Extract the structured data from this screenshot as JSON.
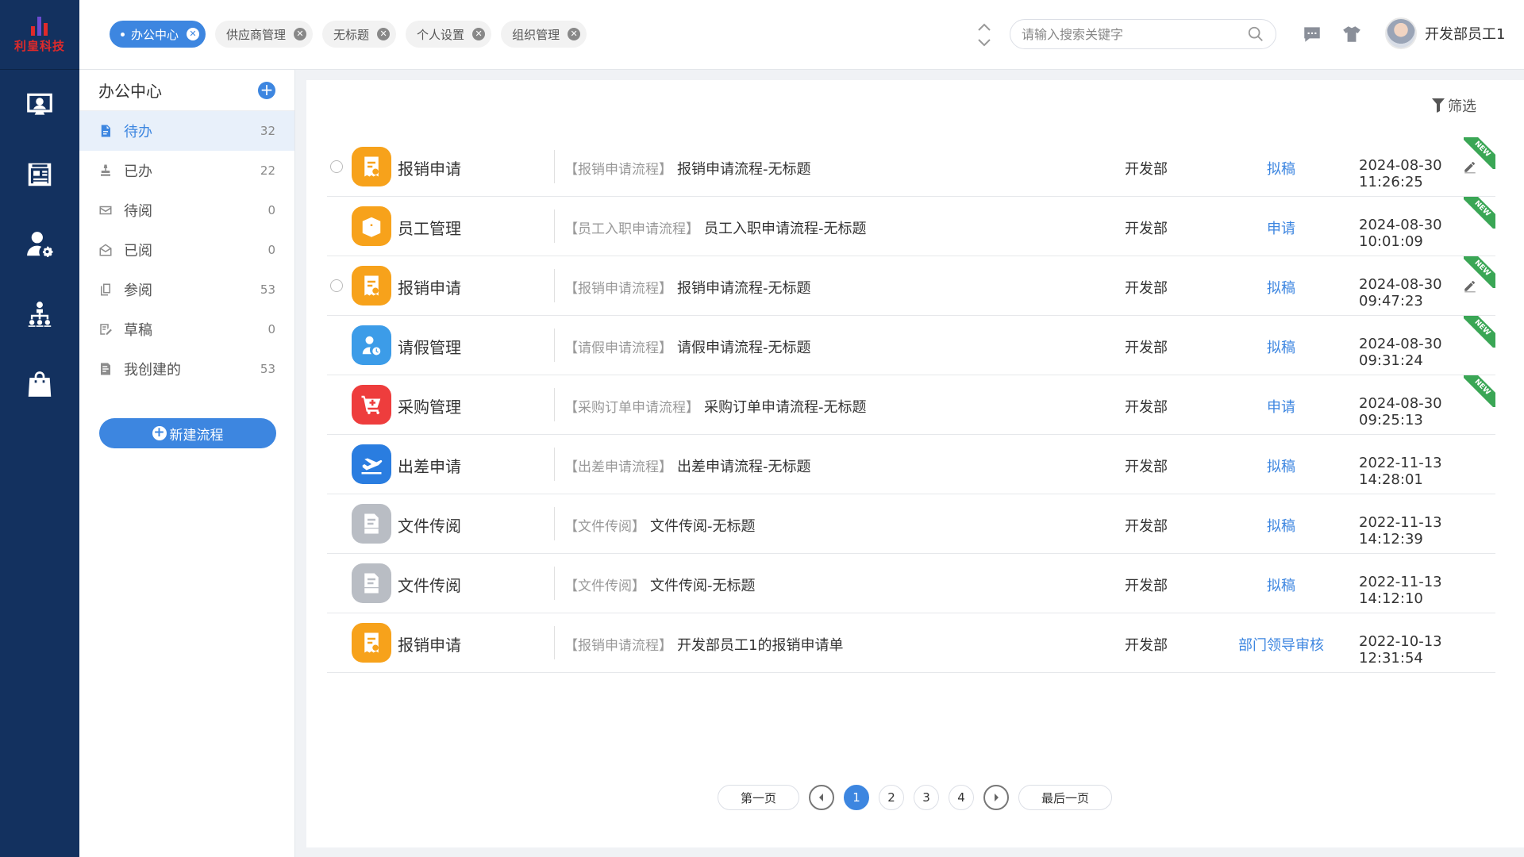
{
  "brand": {
    "name": "利皇科技"
  },
  "topbar": {
    "tabs": [
      {
        "label": "办公中心",
        "active": true
      },
      {
        "label": "供应商管理",
        "active": false
      },
      {
        "label": "无标题",
        "active": false
      },
      {
        "label": "个人设置",
        "active": false
      },
      {
        "label": "组织管理",
        "active": false
      }
    ],
    "search_placeholder": "请输入搜索关键字",
    "user_name": "开发部员工1"
  },
  "sidebar": {
    "title": "办公中心",
    "items": [
      {
        "label": "待办",
        "count": "32",
        "icon": "file-icon",
        "active": true
      },
      {
        "label": "已办",
        "count": "22",
        "icon": "stamp-icon",
        "active": false
      },
      {
        "label": "待阅",
        "count": "0",
        "icon": "mail-icon",
        "active": false
      },
      {
        "label": "已阅",
        "count": "0",
        "icon": "open-mail-icon",
        "active": false
      },
      {
        "label": "参阅",
        "count": "53",
        "icon": "copy-icon",
        "active": false
      },
      {
        "label": "草稿",
        "count": "0",
        "icon": "draft-icon",
        "active": false
      },
      {
        "label": "我创建的",
        "count": "53",
        "icon": "created-icon",
        "active": false
      }
    ],
    "new_flow_label": "新建流程"
  },
  "main": {
    "filter_label": "筛选",
    "rows": [
      {
        "app": "报销申请",
        "icon": "receipt-icon",
        "color": "#f7a21b",
        "type": "【报销申请流程】",
        "title": "报销申请流程-无标题",
        "dept": "开发部",
        "status": "拟稿",
        "time": "2024-08-30 11:26:25",
        "radio": true,
        "edit": true,
        "new": true
      },
      {
        "app": "员工管理",
        "icon": "box-icon",
        "color": "#f7a21b",
        "type": "【员工入职申请流程】",
        "title": "员工入职申请流程-无标题",
        "dept": "开发部",
        "status": "申请",
        "time": "2024-08-30 10:01:09",
        "radio": false,
        "edit": false,
        "new": true
      },
      {
        "app": "报销申请",
        "icon": "receipt-icon",
        "color": "#f7a21b",
        "type": "【报销申请流程】",
        "title": "报销申请流程-无标题",
        "dept": "开发部",
        "status": "拟稿",
        "time": "2024-08-30 09:47:23",
        "radio": true,
        "edit": true,
        "new": true
      },
      {
        "app": "请假管理",
        "icon": "leave-icon",
        "color": "#3c9ce8",
        "type": "【请假申请流程】",
        "title": "请假申请流程-无标题",
        "dept": "开发部",
        "status": "拟稿",
        "time": "2024-08-30 09:31:24",
        "radio": false,
        "edit": false,
        "new": true
      },
      {
        "app": "采购管理",
        "icon": "cart-icon",
        "color": "#ee3d3d",
        "type": "【采购订单申请流程】",
        "title": "采购订单申请流程-无标题",
        "dept": "开发部",
        "status": "申请",
        "time": "2024-08-30 09:25:13",
        "radio": false,
        "edit": false,
        "new": true
      },
      {
        "app": "出差申请",
        "icon": "plane-icon",
        "color": "#2a7de0",
        "type": "【出差申请流程】",
        "title": "出差申请流程-无标题",
        "dept": "开发部",
        "status": "拟稿",
        "time": "2022-11-13 14:28:01",
        "radio": false,
        "edit": false,
        "new": false
      },
      {
        "app": "文件传阅",
        "icon": "doc-default-icon",
        "color": "#b9bdc4",
        "type": "【文件传阅】",
        "title": "文件传阅-无标题",
        "dept": "开发部",
        "status": "拟稿",
        "time": "2022-11-13 14:12:39",
        "radio": false,
        "edit": false,
        "new": false
      },
      {
        "app": "文件传阅",
        "icon": "doc-default-icon",
        "color": "#b9bdc4",
        "type": "【文件传阅】",
        "title": "文件传阅-无标题",
        "dept": "开发部",
        "status": "拟稿",
        "time": "2022-11-13 14:12:10",
        "radio": false,
        "edit": false,
        "new": false
      },
      {
        "app": "报销申请",
        "icon": "receipt-icon",
        "color": "#f7a21b",
        "type": "【报销申请流程】",
        "title": "开发部员工1的报销申请单",
        "dept": "开发部",
        "status": "部门领导审核",
        "time": "2022-10-13 12:31:54",
        "radio": false,
        "edit": false,
        "new": false
      }
    ],
    "new_tag_label": "NEW"
  },
  "pagination": {
    "first_label": "第一页",
    "last_label": "最后一页",
    "pages": [
      "1",
      "2",
      "3",
      "4"
    ],
    "current": "1"
  }
}
